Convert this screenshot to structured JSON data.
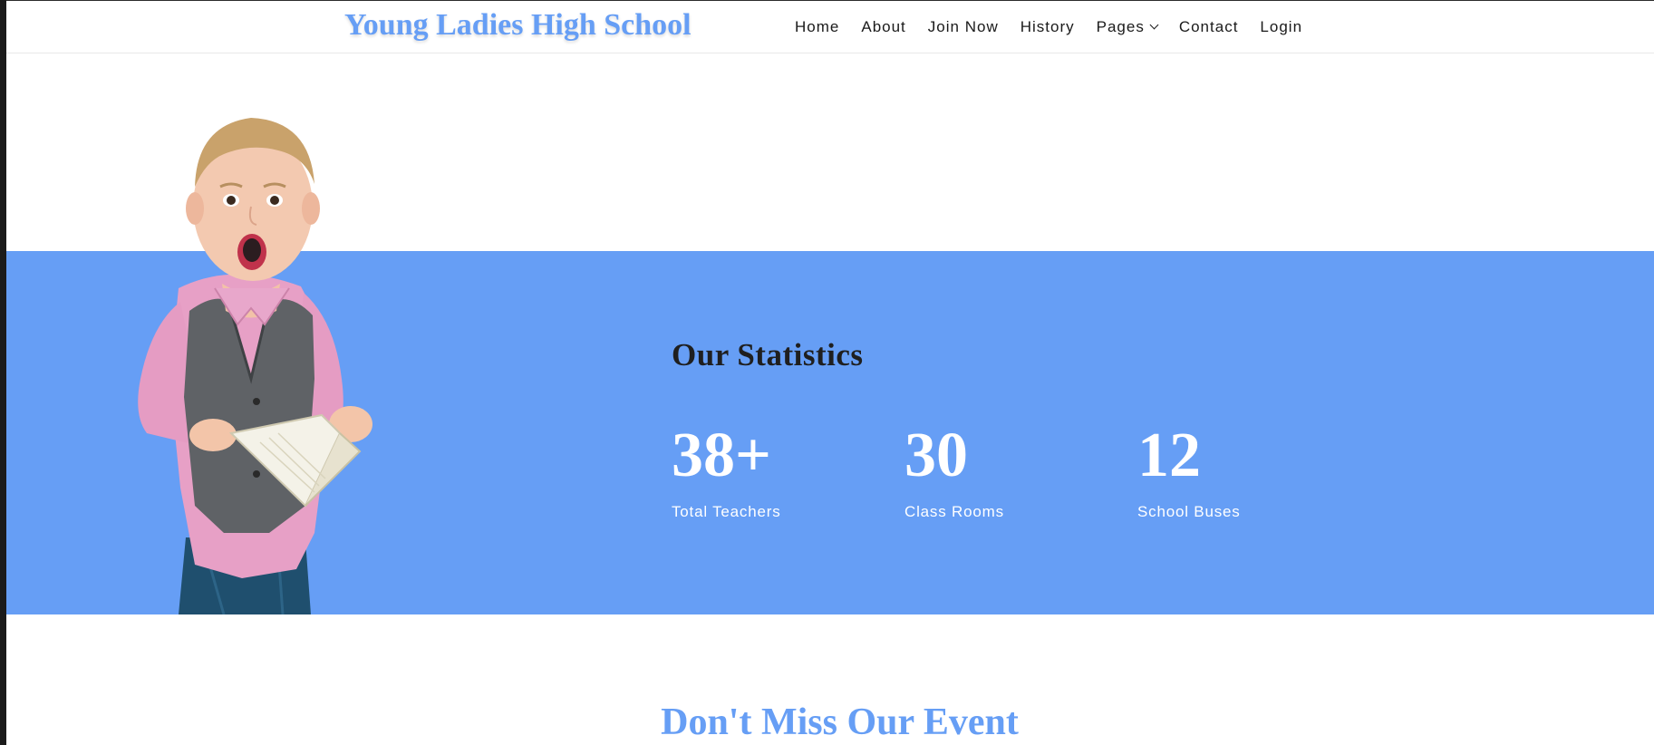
{
  "header": {
    "brand": "Young Ladies High School",
    "nav": [
      {
        "label": "Home"
      },
      {
        "label": "About"
      },
      {
        "label": "Join Now"
      },
      {
        "label": "History"
      },
      {
        "label": "Pages"
      },
      {
        "label": "Contact"
      },
      {
        "label": "Login"
      }
    ]
  },
  "statistics": {
    "title": "Our Statistics",
    "items": [
      {
        "value": "38+",
        "label": "Total Teachers"
      },
      {
        "value": "30",
        "label": "Class Rooms"
      },
      {
        "value": "12",
        "label": "School Buses"
      }
    ]
  },
  "events": {
    "title": "Don't Miss Our Event"
  },
  "colors": {
    "accent": "#669ef5",
    "text_dark": "#1f1f1f"
  },
  "icons": {
    "pages_dropdown": "chevron-down-icon"
  }
}
